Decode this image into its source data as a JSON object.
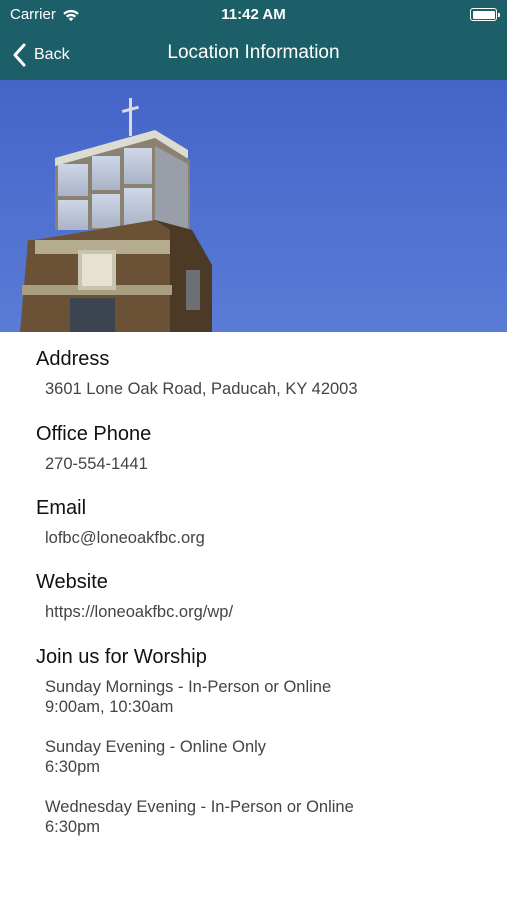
{
  "status_bar": {
    "carrier": "Carrier",
    "time": "11:42 AM",
    "wifi_icon": "wifi-icon",
    "battery_icon": "battery-full-icon"
  },
  "nav": {
    "back_label": "Back",
    "title": "Location Information",
    "back_icon": "chevron-left-icon",
    "bar_color": "#1c5f68"
  },
  "hero": {
    "icon": "church-tower-photo"
  },
  "address": {
    "heading": "Address",
    "value": "3601 Lone Oak Road, Paducah, KY 42003"
  },
  "phone": {
    "heading": "Office Phone",
    "value": "270-554-1441"
  },
  "email": {
    "heading": "Email",
    "value": "lofbc@loneoakfbc.org"
  },
  "website": {
    "heading": "Website",
    "value": "https://loneoakfbc.org/wp/"
  },
  "worship": {
    "heading": "Join us for Worship",
    "services": [
      {
        "name": "Sunday Mornings - In-Person or Online",
        "times": "9:00am, 10:30am"
      },
      {
        "name": "Sunday Evening - Online Only",
        "times": "6:30pm"
      },
      {
        "name": "Wednesday Evening - In-Person or Online",
        "times": "6:30pm"
      }
    ]
  }
}
